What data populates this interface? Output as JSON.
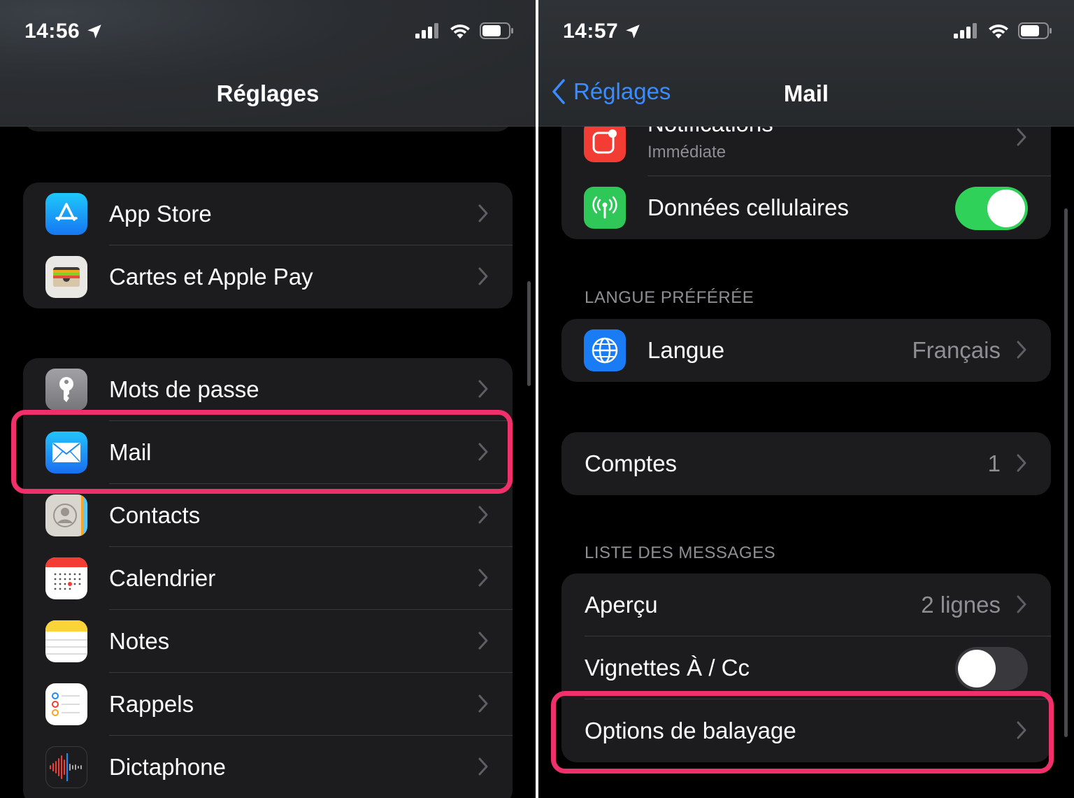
{
  "left": {
    "status": {
      "time": "14:56"
    },
    "nav_title": "Réglages",
    "group1": [
      {
        "label": "App Store",
        "icon": "app-store-icon"
      },
      {
        "label": "Cartes et Apple Pay",
        "icon": "wallet-icon"
      }
    ],
    "group2": [
      {
        "label": "Mots de passe",
        "icon": "key-icon"
      },
      {
        "label": "Mail",
        "icon": "mail-icon"
      },
      {
        "label": "Contacts",
        "icon": "contacts-icon"
      },
      {
        "label": "Calendrier",
        "icon": "calendar-icon"
      },
      {
        "label": "Notes",
        "icon": "notes-icon"
      },
      {
        "label": "Rappels",
        "icon": "reminders-icon"
      },
      {
        "label": "Dictaphone",
        "icon": "voice-memos-icon"
      }
    ]
  },
  "right": {
    "status": {
      "time": "14:57"
    },
    "back_label": "Réglages",
    "nav_title": "Mail",
    "notifications": {
      "label": "Notifications",
      "sublabel": "Immédiate",
      "icon": "notifications-icon"
    },
    "cellular": {
      "label": "Données cellulaires",
      "icon": "antenna-icon",
      "enabled": true
    },
    "section_language": "LANGUE PRÉFÉRÉE",
    "language": {
      "label": "Langue",
      "value": "Français",
      "icon": "globe-icon"
    },
    "accounts": {
      "label": "Comptes",
      "value": "1"
    },
    "section_messages": "LISTE DES MESSAGES",
    "preview": {
      "label": "Aperçu",
      "value": "2 lignes"
    },
    "to_cc": {
      "label": "Vignettes À / Cc",
      "enabled": false
    },
    "swipe": {
      "label": "Options de balayage"
    }
  },
  "colors": {
    "accent_blue": "#3a8cff",
    "highlight": "#f0306a",
    "toggle_on": "#30d158",
    "cell_bg": "#1c1c1e"
  }
}
